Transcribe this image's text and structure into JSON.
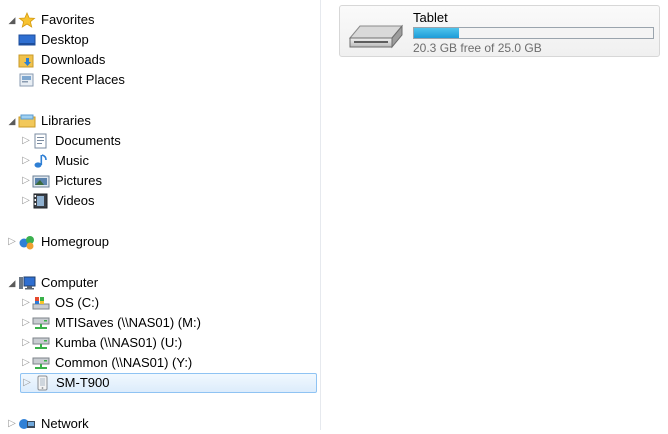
{
  "nav": {
    "favorites": {
      "label": "Favorites",
      "items": [
        {
          "label": "Desktop"
        },
        {
          "label": "Downloads"
        },
        {
          "label": "Recent Places"
        }
      ]
    },
    "libraries": {
      "label": "Libraries",
      "items": [
        {
          "label": "Documents"
        },
        {
          "label": "Music"
        },
        {
          "label": "Pictures"
        },
        {
          "label": "Videos"
        }
      ]
    },
    "homegroup": {
      "label": "Homegroup"
    },
    "computer": {
      "label": "Computer",
      "items": [
        {
          "label": "OS (C:)"
        },
        {
          "label": "MTISaves (\\\\NAS01) (M:)"
        },
        {
          "label": "Kumba (\\\\NAS01) (U:)"
        },
        {
          "label": "Common (\\\\NAS01) (Y:)"
        },
        {
          "label": "SM-T900"
        }
      ]
    },
    "network": {
      "label": "Network"
    }
  },
  "content": {
    "device": {
      "name": "Tablet",
      "free_text": "20.3 GB free of 25.0 GB",
      "used_fraction": 0.19
    }
  },
  "colors": {
    "progress": "#1e9cd8",
    "selection_border": "#8fc3f3"
  }
}
